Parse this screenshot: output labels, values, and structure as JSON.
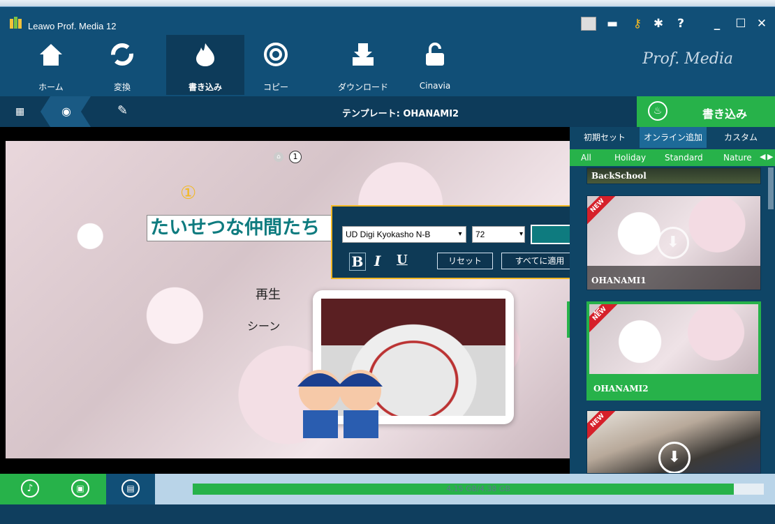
{
  "window": {
    "title": "Leawo Prof. Media 12",
    "controls": [
      "menu-icon",
      "chat-icon",
      "key-icon",
      "gear-icon",
      "help-icon",
      "minimize-icon",
      "maximize-icon",
      "close-icon"
    ]
  },
  "nav": {
    "items": [
      {
        "label": "ホーム",
        "icon": "home-icon"
      },
      {
        "label": "変換",
        "icon": "convert-icon"
      },
      {
        "label": "書き込み",
        "icon": "burn-icon"
      },
      {
        "label": "コピー",
        "icon": "copy-icon"
      },
      {
        "label": "ダウンロード",
        "icon": "download-icon"
      },
      {
        "label": "Cinavia",
        "icon": "cinavia-icon"
      }
    ],
    "brand": "Prof. Media"
  },
  "subbar": {
    "template_label": "テンプレート: OHANAMI2",
    "burn_button": "書き込み"
  },
  "canvas": {
    "page_indicator": "1",
    "title_marker": "①",
    "title_text": "たいせつな仲間たち",
    "play_label": "再生",
    "scene_label": "シーン"
  },
  "text_editor": {
    "font": "UD Digi Kyokasho N-B",
    "size": "72",
    "color": "#0e7b7f",
    "bold": "B",
    "italic": "I",
    "underline": "U",
    "reset": "リセット",
    "apply_all": "すべてに適用"
  },
  "right_panel": {
    "tabs": [
      "初期セット",
      "オンライン追加",
      "カスタム"
    ],
    "categories": [
      "All",
      "Holiday",
      "Standard",
      "Nature"
    ],
    "templates": [
      {
        "name": "BackSchool",
        "badge": ""
      },
      {
        "name": "OHANAMI1",
        "badge": "NEW"
      },
      {
        "name": "OHANAMI2",
        "badge": "NEW"
      },
      {
        "name": "",
        "badge": "NEW"
      }
    ]
  },
  "bottom": {
    "capacity": "4.15 GB/4.38 GB",
    "progress": 0.947
  },
  "colors": {
    "accent_green": "#27b24a",
    "nav_bg": "#114f77",
    "dark_bar": "#0d3b5a",
    "title_teal": "#0e7b7f",
    "highlight": "#f2b823"
  }
}
